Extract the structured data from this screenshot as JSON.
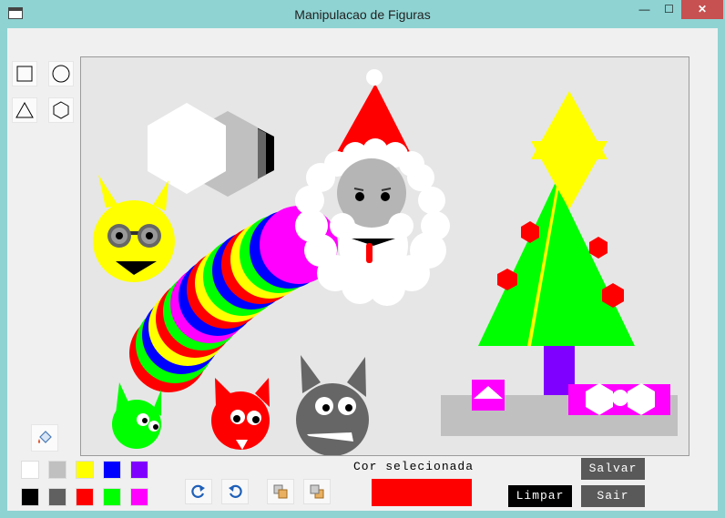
{
  "window": {
    "title": "Manipulacao de Figuras",
    "min_glyph": "—",
    "max_glyph": "☐",
    "close_glyph": "✕"
  },
  "tools": [
    {
      "name": "square-tool",
      "icon": "square-icon"
    },
    {
      "name": "circle-tool",
      "icon": "circle-icon"
    },
    {
      "name": "triangle-tool",
      "icon": "triangle-icon"
    },
    {
      "name": "hexagon-tool",
      "icon": "hexagon-icon"
    }
  ],
  "fill_tool": {
    "icon": "paint-bucket-icon"
  },
  "palette": {
    "top": [
      "#ffffff",
      "#c0c0c0",
      "#ffff00",
      "#0000ff",
      "#8000ff"
    ],
    "bottom": [
      "#000000",
      "#606060",
      "#ff0000",
      "#00ff00",
      "#ff00ff"
    ]
  },
  "actions": [
    {
      "name": "rotate-clockwise-button",
      "icon": "rotate-cw-icon"
    },
    {
      "name": "rotate-counterclockwise-button",
      "icon": "rotate-ccw-icon"
    },
    {
      "name": "bring-to-front-button",
      "icon": "bring-front-icon"
    },
    {
      "name": "send-to-back-button",
      "icon": "send-back-icon"
    }
  ],
  "selected_color": {
    "label": "Cor selecionada",
    "color": "#ff0000"
  },
  "buttons": {
    "limpar": "Limpar",
    "salvar": "Salvar",
    "sair": "Sair"
  },
  "colors": {
    "dark_button": "#595959",
    "black_button": "#000000"
  }
}
